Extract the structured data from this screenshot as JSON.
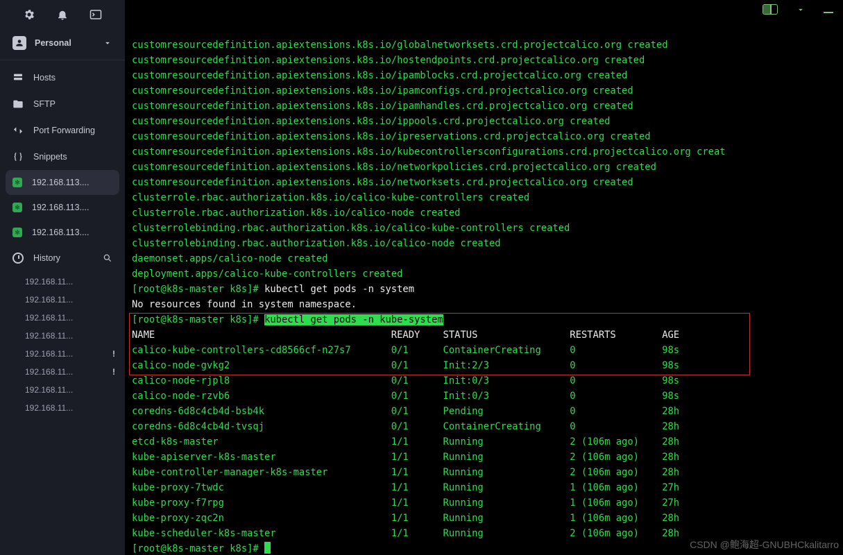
{
  "workspace": {
    "label": "Personal"
  },
  "nav": {
    "hosts": "Hosts",
    "sftp": "SFTP",
    "portfwd": "Port Forwarding",
    "snippets": "Snippets",
    "history": "History"
  },
  "hosts": [
    {
      "label": "192.168.113...."
    },
    {
      "label": "192.168.113...."
    },
    {
      "label": "192.168.113...."
    }
  ],
  "history_items": [
    {
      "label": "192.168.11...",
      "bang": false
    },
    {
      "label": "192.168.11...",
      "bang": false
    },
    {
      "label": "192.168.11...",
      "bang": false
    },
    {
      "label": "192.168.11...",
      "bang": false
    },
    {
      "label": "192.168.11...",
      "bang": true
    },
    {
      "label": "192.168.11...",
      "bang": true
    },
    {
      "label": "192.168.11...",
      "bang": false
    },
    {
      "label": "192.168.11...",
      "bang": false
    }
  ],
  "term": {
    "crd_lines": [
      "customresourcedefinition.apiextensions.k8s.io/globalnetworksets.crd.projectcalico.org created",
      "customresourcedefinition.apiextensions.k8s.io/hostendpoints.crd.projectcalico.org created",
      "customresourcedefinition.apiextensions.k8s.io/ipamblocks.crd.projectcalico.org created",
      "customresourcedefinition.apiextensions.k8s.io/ipamconfigs.crd.projectcalico.org created",
      "customresourcedefinition.apiextensions.k8s.io/ipamhandles.crd.projectcalico.org created",
      "customresourcedefinition.apiextensions.k8s.io/ippools.crd.projectcalico.org created",
      "customresourcedefinition.apiextensions.k8s.io/ipreservations.crd.projectcalico.org created",
      "customresourcedefinition.apiextensions.k8s.io/kubecontrollersconfigurations.crd.projectcalico.org creat",
      "customresourcedefinition.apiextensions.k8s.io/networkpolicies.crd.projectcalico.org created",
      "customresourcedefinition.apiextensions.k8s.io/networksets.crd.projectcalico.org created",
      "clusterrole.rbac.authorization.k8s.io/calico-kube-controllers created",
      "clusterrole.rbac.authorization.k8s.io/calico-node created",
      "clusterrolebinding.rbac.authorization.k8s.io/calico-kube-controllers created",
      "clusterrolebinding.rbac.authorization.k8s.io/calico-node created",
      "daemonset.apps/calico-node created",
      "deployment.apps/calico-kube-controllers created"
    ],
    "prompt1_left": "[root@k8s-master k8s]#",
    "prompt1_cmd": "kubectl get pods -n system",
    "no_resources": "No resources found in system namespace.",
    "prompt2_left": "[root@k8s-master k8s]#",
    "prompt2_cmd": "kubectl get pods -n kube-system",
    "header": {
      "name": "NAME",
      "ready": "READY",
      "status": "STATUS",
      "restarts": "RESTARTS",
      "age": "AGE"
    },
    "rows": [
      {
        "n": "calico-kube-controllers-cd8566cf-n27s7",
        "r": "0/1",
        "s": "ContainerCreating",
        "x": "0",
        "a": "98s"
      },
      {
        "n": "calico-node-gvkg2",
        "r": "0/1",
        "s": "Init:2/3",
        "x": "0",
        "a": "98s"
      },
      {
        "n": "calico-node-rjpl8",
        "r": "0/1",
        "s": "Init:0/3",
        "x": "0",
        "a": "98s"
      },
      {
        "n": "calico-node-rzvb6",
        "r": "0/1",
        "s": "Init:0/3",
        "x": "0",
        "a": "98s"
      },
      {
        "n": "coredns-6d8c4cb4d-bsb4k",
        "r": "0/1",
        "s": "Pending",
        "x": "0",
        "a": "28h"
      },
      {
        "n": "coredns-6d8c4cb4d-tvsqj",
        "r": "0/1",
        "s": "ContainerCreating",
        "x": "0",
        "a": "28h"
      },
      {
        "n": "etcd-k8s-master",
        "r": "1/1",
        "s": "Running",
        "x": "2 (106m ago)",
        "a": "28h"
      },
      {
        "n": "kube-apiserver-k8s-master",
        "r": "1/1",
        "s": "Running",
        "x": "2 (106m ago)",
        "a": "28h"
      },
      {
        "n": "kube-controller-manager-k8s-master",
        "r": "1/1",
        "s": "Running",
        "x": "2 (106m ago)",
        "a": "28h"
      },
      {
        "n": "kube-proxy-7twdc",
        "r": "1/1",
        "s": "Running",
        "x": "1 (106m ago)",
        "a": "27h"
      },
      {
        "n": "kube-proxy-f7rpg",
        "r": "1/1",
        "s": "Running",
        "x": "1 (106m ago)",
        "a": "27h"
      },
      {
        "n": "kube-proxy-zqc2n",
        "r": "1/1",
        "s": "Running",
        "x": "1 (106m ago)",
        "a": "28h"
      },
      {
        "n": "kube-scheduler-k8s-master",
        "r": "1/1",
        "s": "Running",
        "x": "2 (106m ago)",
        "a": "28h"
      }
    ],
    "prompt3_left": "[root@k8s-master k8s]#"
  },
  "watermark": "CSDN @鲍海超-GNUBHCkalitarro"
}
